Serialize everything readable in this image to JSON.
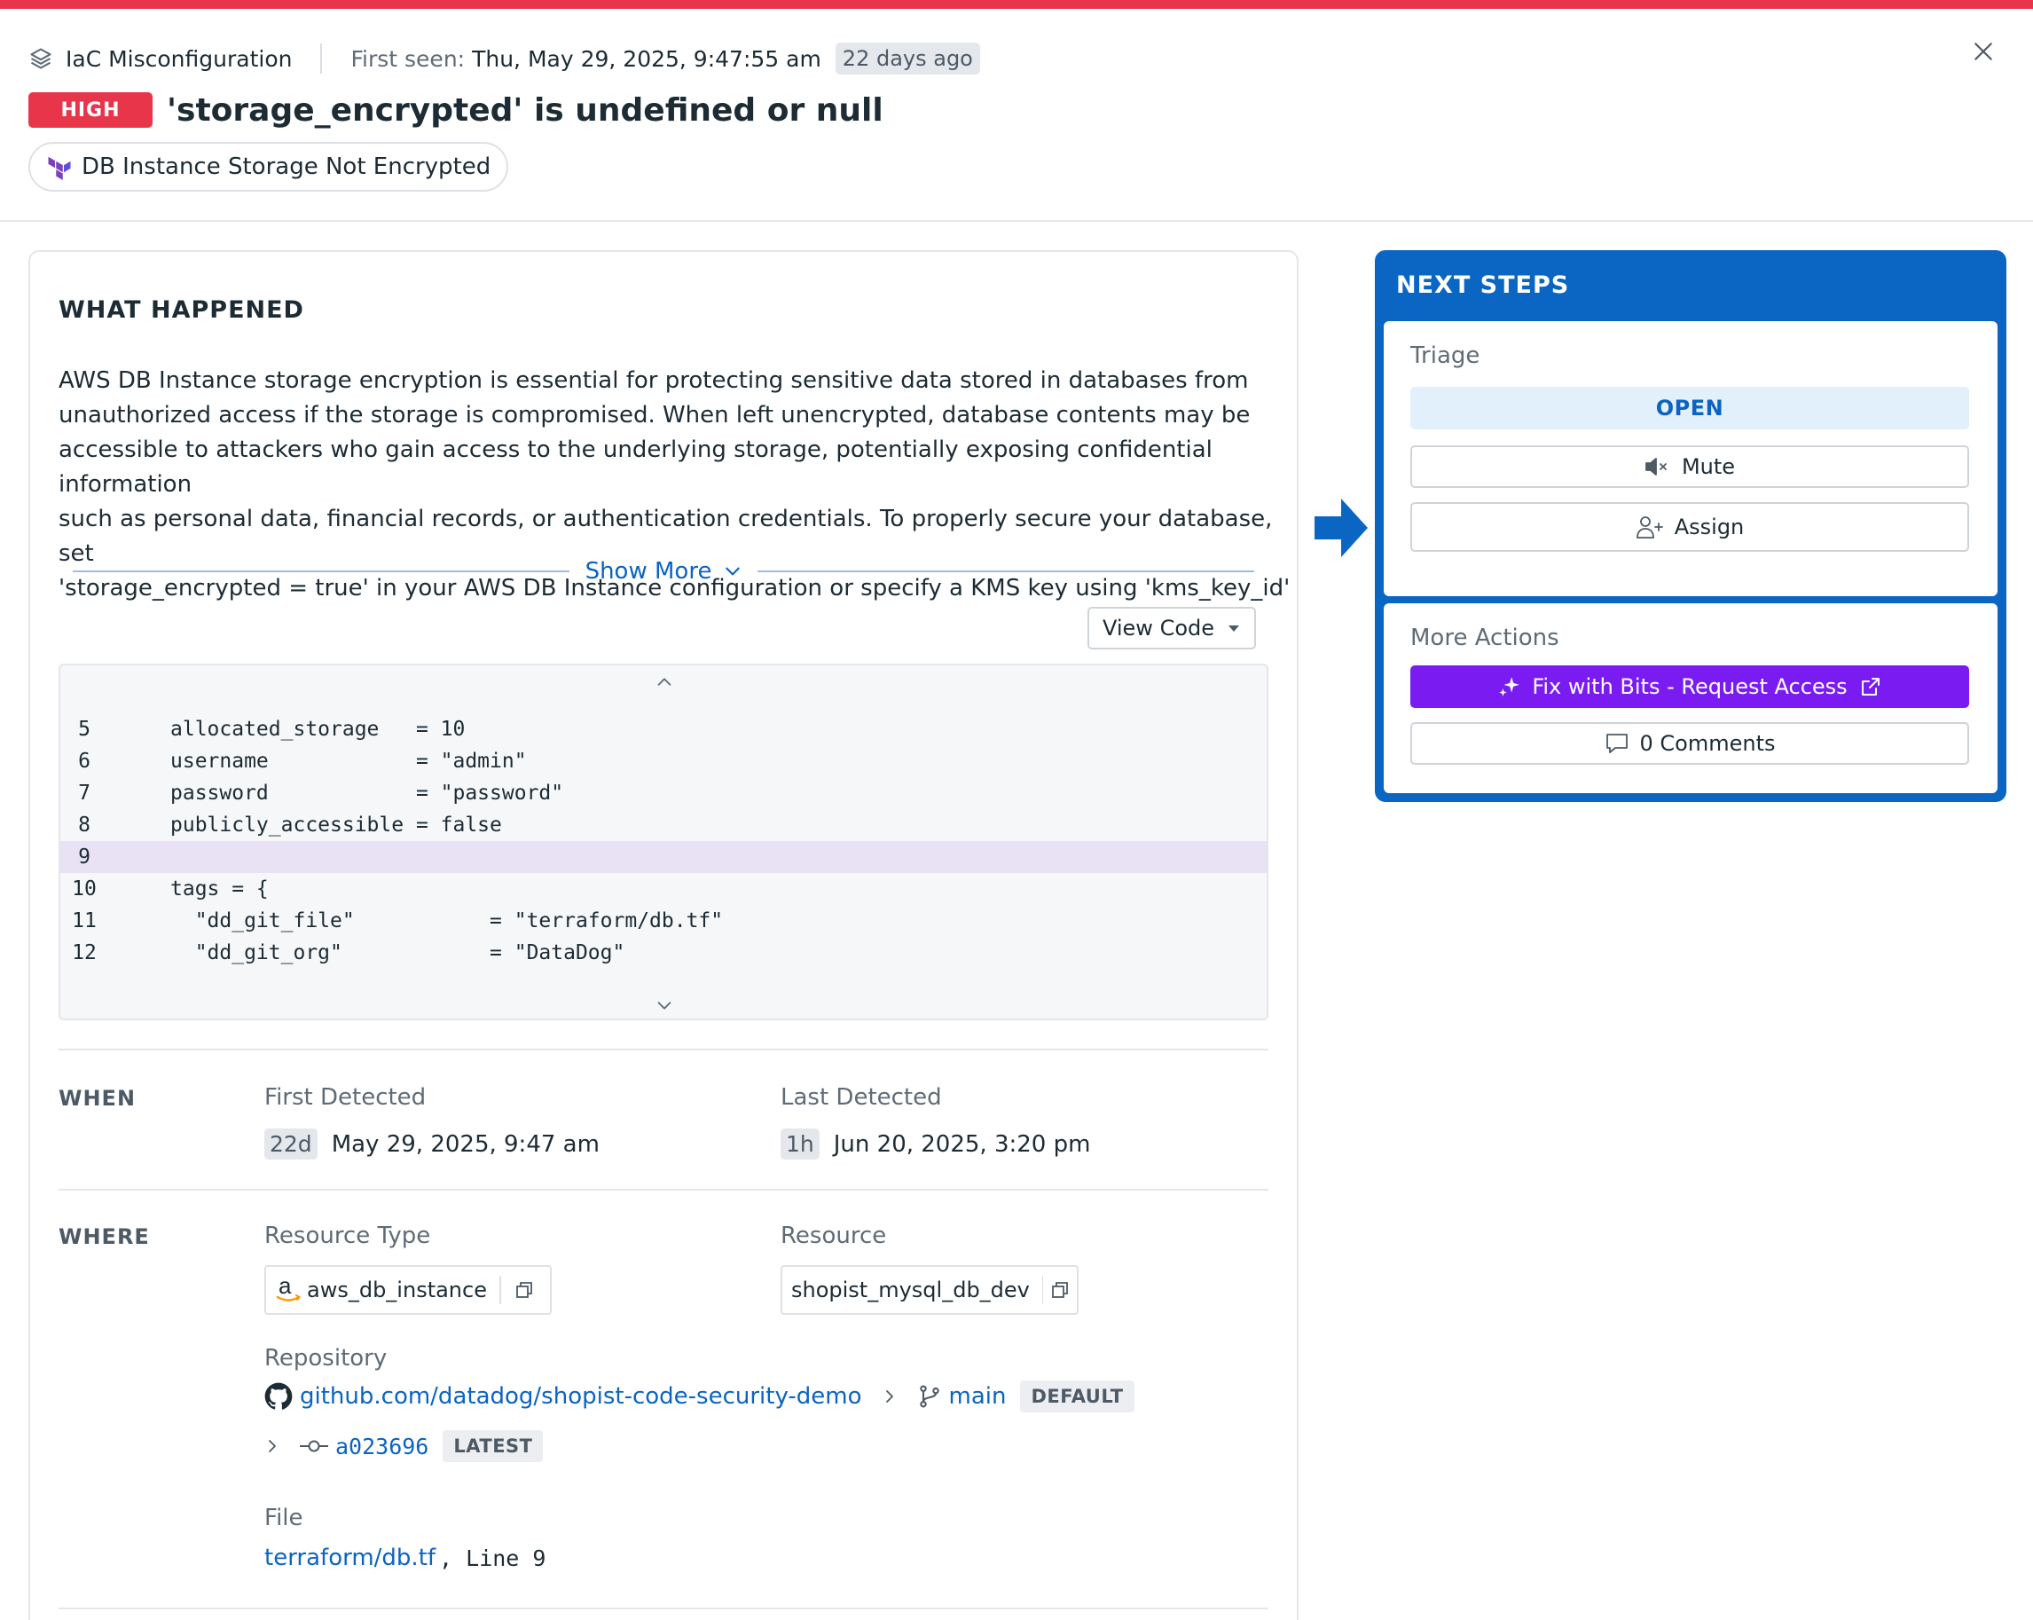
{
  "header": {
    "type_label": "IaC Misconfiguration",
    "first_seen_label": "First seen:",
    "first_seen_value": "Thu, May 29, 2025, 9:47:55 am",
    "first_seen_ago": "22 days ago",
    "severity": "HIGH",
    "title": "'storage_encrypted' is undefined or null",
    "rule_name": "DB Instance Storage Not Encrypted"
  },
  "what_happened": {
    "title": "WHAT HAPPENED",
    "description": "AWS DB Instance storage encryption is essential for protecting sensitive data stored in databases from\nunauthorized access if the storage is compromised. When left unencrypted, database contents may be\naccessible to attackers who gain access to the underlying storage, potentially exposing confidential information\nsuch as personal data, financial records, or authentication credentials. To properly secure your database, set\n'storage_encrypted = true' in your AWS DB Instance configuration or specify a KMS key using 'kms_key_id'",
    "show_more": "Show More",
    "view_code": "View Code"
  },
  "code": {
    "highlight_line": "9",
    "lines": [
      {
        "num": "5",
        "text": "allocated_storage   = 10"
      },
      {
        "num": "6",
        "text": "username            = \"admin\""
      },
      {
        "num": "7",
        "text": "password            = \"password\""
      },
      {
        "num": "8",
        "text": "publicly_accessible = false"
      },
      {
        "num": "9",
        "text": ""
      },
      {
        "num": "10",
        "text": "tags = {"
      },
      {
        "num": "11",
        "text": "  \"dd_git_file\"           = \"terraform/db.tf\""
      },
      {
        "num": "12",
        "text": "  \"dd_git_org\"            = \"DataDog\""
      }
    ]
  },
  "when": {
    "label": "WHEN",
    "first_detected_label": "First Detected",
    "first_detected_ago": "22d",
    "first_detected_value": "May 29, 2025, 9:47 am",
    "last_detected_label": "Last Detected",
    "last_detected_ago": "1h",
    "last_detected_value": "Jun 20, 2025, 3:20 pm"
  },
  "where": {
    "label": "WHERE",
    "resource_type_label": "Resource Type",
    "resource_type_value": "aws_db_instance",
    "resource_label": "Resource",
    "resource_value": "shopist_mysql_db_dev",
    "repository_label": "Repository",
    "repository_value": "github.com/datadog/shopist-code-security-demo",
    "branch": "main",
    "branch_tag": "DEFAULT",
    "commit": "a023696",
    "commit_tag": "LATEST",
    "file_label": "File",
    "file_value": "terraform/db.tf",
    "file_line": ", Line 9"
  },
  "next_steps": {
    "title": "NEXT STEPS",
    "triage_label": "Triage",
    "status": "OPEN",
    "mute_label": "Mute",
    "assign_label": "Assign",
    "more_actions_label": "More Actions",
    "fix_label": "Fix with Bits - Request Access",
    "comments_label": "0 Comments"
  },
  "colors": {
    "severity_high": "#e8354a",
    "accent_blue": "#0b66c3",
    "bits_purple": "#7a1cf1",
    "code_highlight": "#e8e2f4"
  },
  "icons": [
    "layers-icon",
    "close-icon",
    "terraform-icon",
    "chevron-down-icon",
    "caret-down-icon",
    "chevron-up-icon",
    "copy-icon",
    "aws-icon",
    "github-icon",
    "chevron-right-icon",
    "branch-icon",
    "commit-icon",
    "mute-icon",
    "assign-user-icon",
    "sparkle-icon",
    "external-link-icon",
    "comment-icon",
    "arrow-right-icon"
  ]
}
